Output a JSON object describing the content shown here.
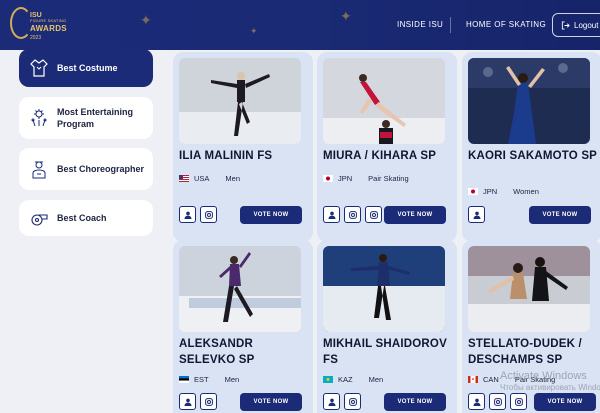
{
  "header": {
    "logo": {
      "line1": "ISU",
      "line2": "FIGURE SKATING",
      "line3": "AWARDS",
      "line4": "2023"
    },
    "nav": [
      "INSIDE ISU",
      "HOME OF SKATING"
    ],
    "logout_label": "Logout"
  },
  "sidebar": {
    "items": [
      {
        "label": "Best Costume",
        "icon": "costume-icon",
        "active": true
      },
      {
        "label": "Most Entertaining Program",
        "icon": "fireworks-icon",
        "active": false
      },
      {
        "label": "Best Choreographer",
        "icon": "choreographer-icon",
        "active": false
      },
      {
        "label": "Best Coach",
        "icon": "whistle-icon",
        "active": false
      }
    ]
  },
  "cards": [
    {
      "name": "ILIA MALININ FS",
      "country": "USA",
      "category": "Men",
      "flag": "usa"
    },
    {
      "name": "MIURA / KIHARA SP",
      "country": "JPN",
      "category": "Pair Skating",
      "flag": "jpn"
    },
    {
      "name": "KAORI SAKAMOTO SP",
      "country": "JPN",
      "category": "Women",
      "flag": "jpn"
    },
    {
      "name": "ALEKSANDR SELEVKO SP",
      "country": "EST",
      "category": "Men",
      "flag": "est"
    },
    {
      "name": "MIKHAIL SHAIDOROV FS",
      "country": "KAZ",
      "category": "Men",
      "flag": "kaz"
    },
    {
      "name": "STELLATO-DUDEK / DESCHAMPS SP",
      "country": "CAN",
      "category": "Pair Skating",
      "flag": "can"
    }
  ],
  "vote_label": "VOTE NOW",
  "watermark": {
    "line1": "Activate Windows",
    "line2": "Чтобы активировать Windows"
  },
  "colors": {
    "primary": "#1b2b78",
    "gold": "#d3ac55",
    "card_bg": "#d9e3f4"
  }
}
